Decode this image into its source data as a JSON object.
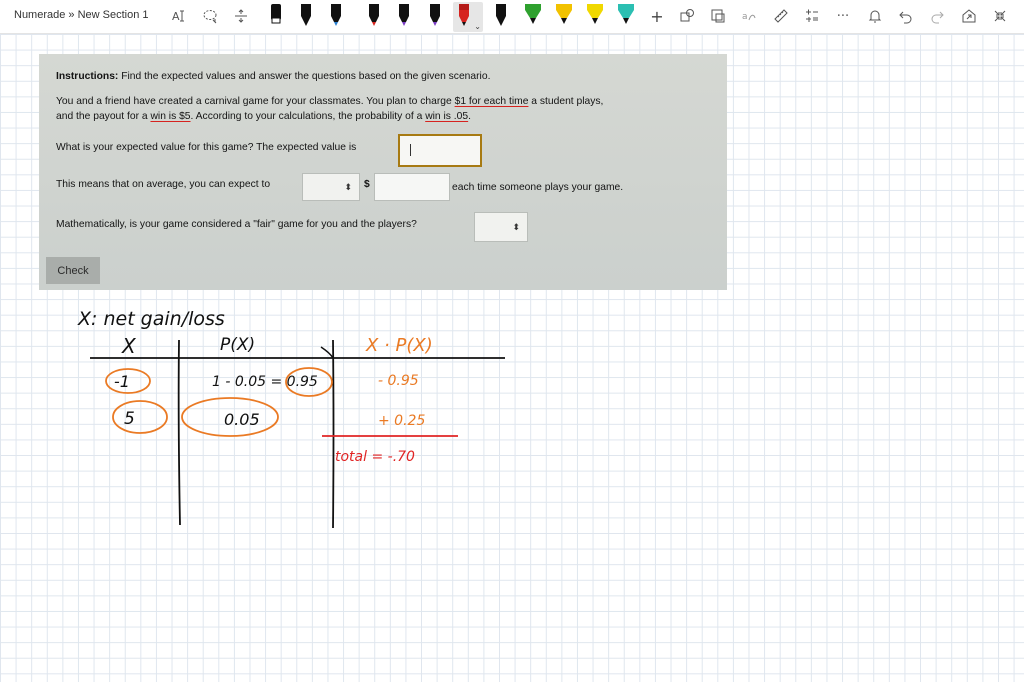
{
  "toolbar": {
    "breadcrumb": "Numerade » New Section 1",
    "icons": [
      "type-icon",
      "lasso-icon",
      "insert-space-icon",
      "eraser-icon",
      "pen-icon",
      "add-icon",
      "shapes-icon",
      "ink-to-shape-icon",
      "ink-to-text-icon",
      "ruler-icon",
      "math-icon",
      "more-icon",
      "bell-icon",
      "undo-icon",
      "redo-icon",
      "share-icon",
      "collapse-icon"
    ],
    "more_label": "···",
    "add_label": "+",
    "pen_colors": [
      "#111111",
      "#111111",
      "#111111",
      "#2a7fd0",
      "#d6231f",
      "#7a3cc2",
      "#7a3cc2",
      "#d6231f",
      "#111111",
      "#2fa12f",
      "#f2c200",
      "#f0d800",
      "#2bbfb2",
      "#f08a1a"
    ]
  },
  "problem": {
    "instructions_label": "Instructions:",
    "instructions_text": " Find the expected values and answer the questions based on the given scenario.",
    "scenario_1a": "You and a friend have created a carnival game for your classmates. You plan to charge ",
    "scenario_1b": "$1 for each time",
    "scenario_1c": " a student plays,",
    "scenario_2a": "and the payout for a ",
    "scenario_2b": "win is $5",
    "scenario_2c": ". According to your calculations, the probability of a ",
    "scenario_2d": "win is .05",
    "scenario_2e": ".",
    "question_1": "What is your expected value for this game? The expected value is",
    "question_2a": "This means that on average, you can expect to",
    "question_2_dollar": "$",
    "question_2b": "each time someone plays your game.",
    "question_3": "Mathematically, is your game considered a \"fair\" game for you and the players?",
    "select_arrow": "⬍",
    "check_button": "Check"
  },
  "notes": {
    "heading": "X: net gain/loss",
    "col_x": "X",
    "col_px": "P(X)",
    "col_xpx": "X · P(X)",
    "row1_x": "-1",
    "row1_px": "1 - 0.05 = 0.95",
    "row1_xpx": "- 0.95",
    "row2_x": "5",
    "row2_px": "0.05",
    "row2_xpx": "+ 0.25",
    "total": "total = -.70",
    "colors": {
      "ink": "#111111",
      "orange": "#ea7a24",
      "red": "#e02424"
    }
  }
}
